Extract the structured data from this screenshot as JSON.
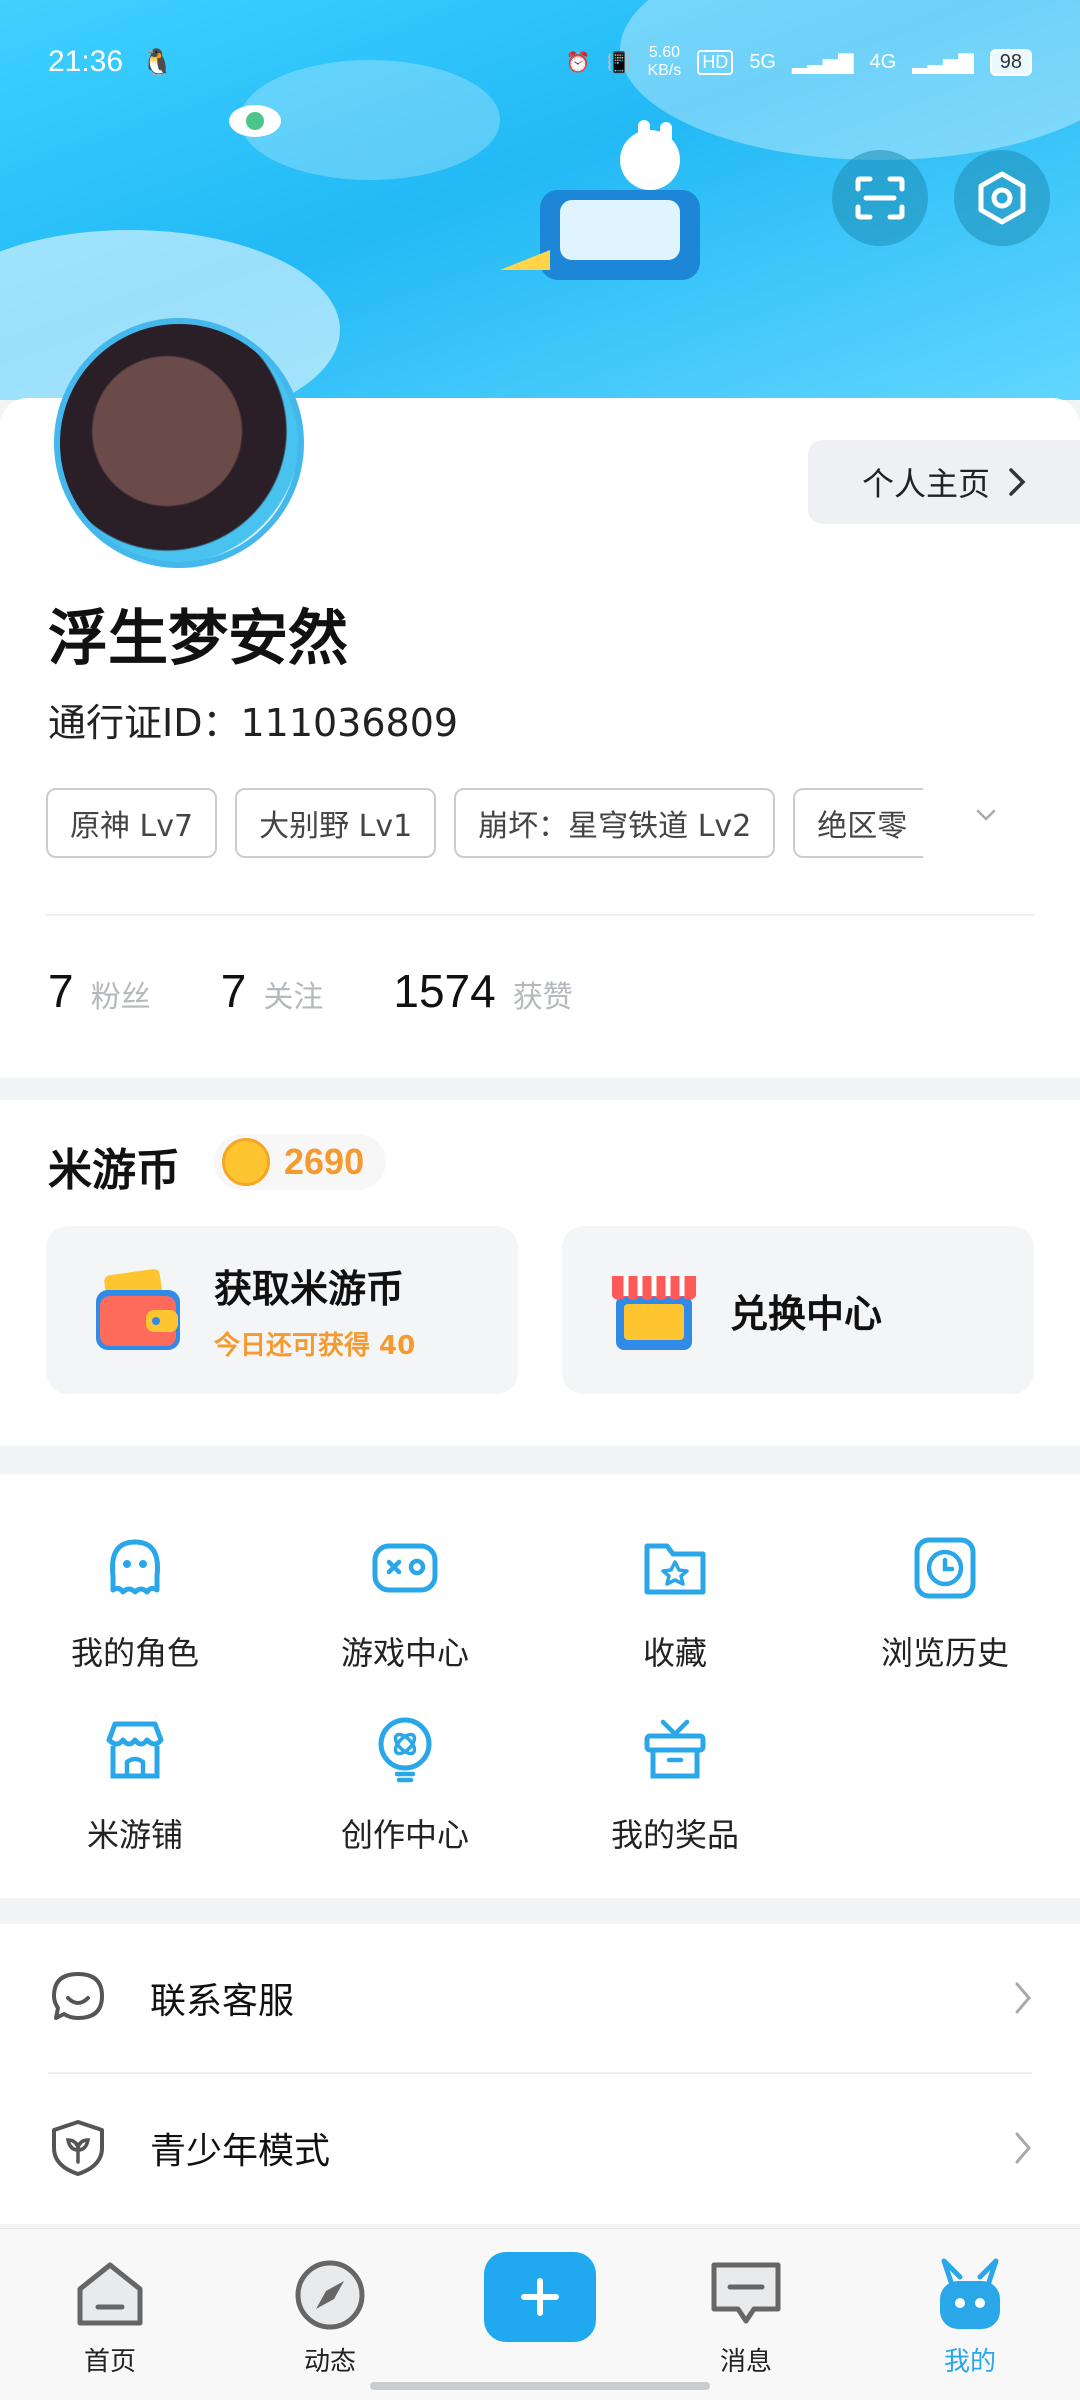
{
  "status_bar": {
    "time": "21:36",
    "speed": "5.60",
    "speed_unit": "KB/s",
    "net1": "5G",
    "net2": "4G",
    "battery": "98"
  },
  "profile": {
    "homepage_label": "个人主页",
    "name": "浮生梦安然",
    "uid": "通行证ID：111036809",
    "tags": [
      "原神 Lv7",
      "大别野 Lv1",
      "崩坏：星穹铁道 Lv2",
      "绝区零"
    ],
    "stats": [
      {
        "value": "7",
        "label": "粉丝"
      },
      {
        "value": "7",
        "label": "关注"
      },
      {
        "value": "1574",
        "label": "获赞"
      }
    ]
  },
  "coins": {
    "title": "米游币",
    "balance": "2690",
    "card_earn_title": "获取米游币",
    "card_earn_sub": "今日还可获得 40",
    "card_exchange_title": "兑换中心"
  },
  "grid": [
    {
      "label": "我的角色",
      "icon": "character-icon"
    },
    {
      "label": "游戏中心",
      "icon": "gamepad-icon"
    },
    {
      "label": "收藏",
      "icon": "favorites-folder-icon"
    },
    {
      "label": "浏览历史",
      "icon": "history-clock-icon"
    },
    {
      "label": "米游铺",
      "icon": "shop-icon"
    },
    {
      "label": "创作中心",
      "icon": "creator-bulb-icon"
    },
    {
      "label": "我的奖品",
      "icon": "gift-icon"
    }
  ],
  "list": [
    {
      "label": "联系客服",
      "icon": "customer-service-icon"
    },
    {
      "label": "青少年模式",
      "icon": "youth-shield-icon"
    }
  ],
  "nav": {
    "home": "首页",
    "feed": "动态",
    "messages": "消息",
    "mine": "我的"
  },
  "colors": {
    "accent": "#21a9ef",
    "coin_orange": "#f59a2f",
    "banner": "#22b9f5"
  }
}
